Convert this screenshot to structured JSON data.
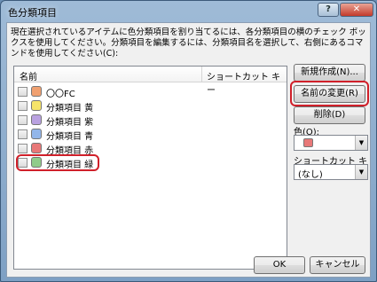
{
  "window": {
    "title": "色分類項目"
  },
  "description": "現在選択されているアイテムに色分類項目を割り当てるには、各分類項目の横のチェック ボックスを使用してください。分類項目を編集するには、分類項目名を選択して、右側にあるコマンドを使用してください(C):",
  "list": {
    "col_name": "名前",
    "col_shortcut": "ショートカット キー",
    "items": [
      {
        "label": "〇〇FC",
        "color": "#f0a070"
      },
      {
        "label": "分類項目 黄",
        "color": "#f6e46a"
      },
      {
        "label": "分類項目 紫",
        "color": "#b9a1e0"
      },
      {
        "label": "分類項目 青",
        "color": "#92b6ea"
      },
      {
        "label": "分類項目 赤",
        "color": "#e87878"
      },
      {
        "label": "分類項目 緑",
        "color": "#90cc8a"
      }
    ]
  },
  "buttons": {
    "new": "新規作成(N)...",
    "rename": "名前の変更(R)",
    "delete": "削除(D)",
    "ok": "OK",
    "cancel": "キャンセル"
  },
  "color_field": {
    "label": "色(O):",
    "value_color": "#e87878"
  },
  "shortcut_field": {
    "label": "ショートカット キー(S):",
    "value": "(なし)"
  },
  "highlight_color": "#d0202a"
}
